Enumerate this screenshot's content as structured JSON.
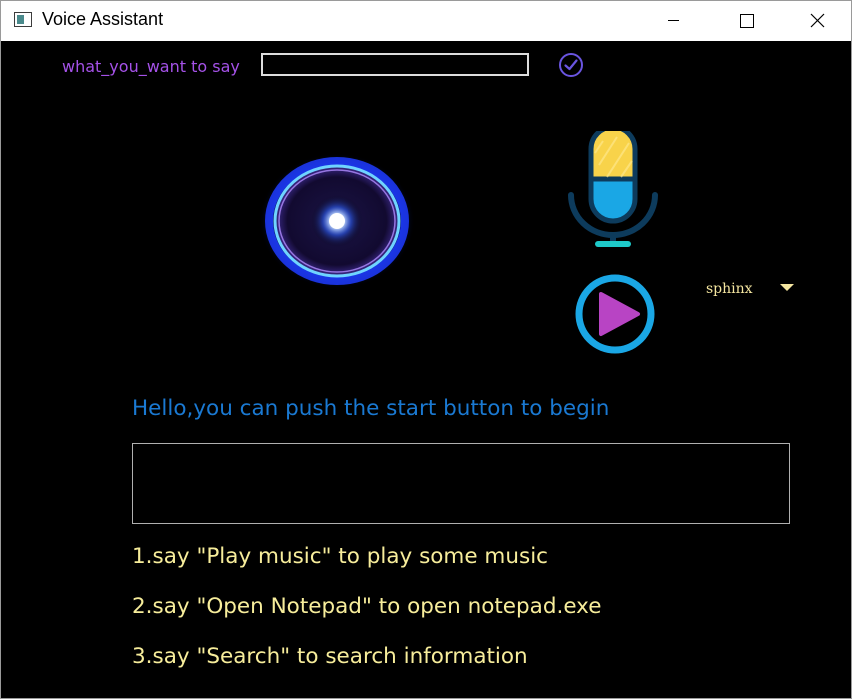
{
  "window": {
    "title": "Voice Assistant",
    "controls": [
      "minimize",
      "maximize",
      "close"
    ]
  },
  "say_bar": {
    "label": "what_you_want to say",
    "input_value": "",
    "confirm_icon": "check-circle-icon",
    "confirm_color": "#6a55e0"
  },
  "visuals": {
    "orb_icon": "glowing-orb",
    "mic_icon": "microphone-icon",
    "play_icon": "play-circle-icon"
  },
  "engine": {
    "selected": "sphinx"
  },
  "main": {
    "greeting": "Hello,you can push the start button to begin",
    "output_text": ""
  },
  "instructions": [
    "1.say \"Play music\" to play some music",
    "2.say \"Open Notepad\" to open notepad.exe",
    "3.say \"Search\" to search information"
  ],
  "colors": {
    "background": "#000000",
    "label_purple": "#a552e8",
    "greeting_blue": "#1a79d2",
    "instruction_yellow": "#f7ed9b",
    "mic_yellow": "#f8d34a",
    "mic_blue": "#1aa7e5",
    "play_ring": "#1aa7e5",
    "play_triangle": "#b844c4"
  }
}
